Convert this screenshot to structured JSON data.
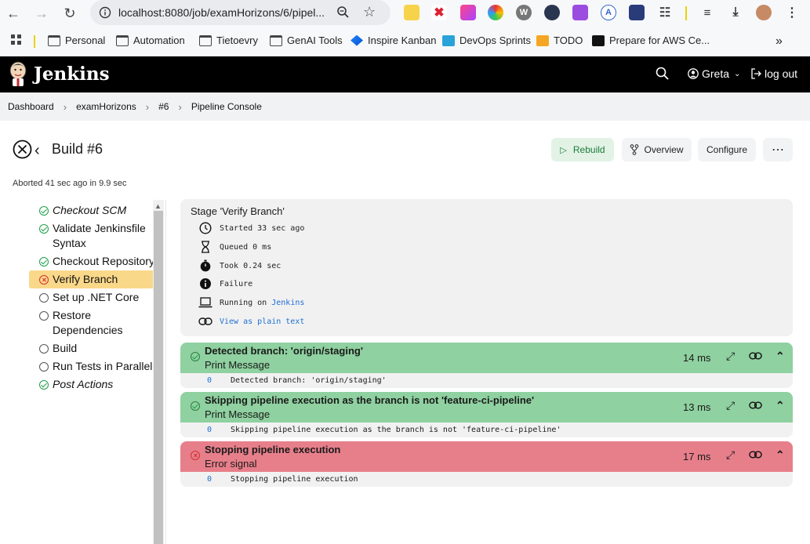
{
  "browser": {
    "url": "localhost:8080/job/examHorizons/6/pipel...",
    "bookmarks": [
      "Personal",
      "Automation",
      "Tietoevry",
      "GenAI Tools",
      "Inspire Kanban",
      "DevOps Sprints",
      "TODO",
      "Prepare for AWS Ce..."
    ]
  },
  "header": {
    "brand": "Jenkins",
    "user": "Greta",
    "logout": "log out"
  },
  "breadcrumb": [
    "Dashboard",
    "examHorizons",
    "#6",
    "Pipeline Console"
  ],
  "build": {
    "title": "Build #6",
    "status_line": "Aborted 41 sec ago in 9.9 sec",
    "buttons": {
      "rebuild": "Rebuild",
      "overview": "Overview",
      "configure": "Configure"
    }
  },
  "stages": [
    {
      "label": "Checkout SCM",
      "status": "success",
      "italic": true
    },
    {
      "label": "Validate Jenkinsfile Syntax",
      "status": "success",
      "italic": false
    },
    {
      "label": "Checkout Repository",
      "status": "success",
      "italic": false
    },
    {
      "label": "Verify Branch",
      "status": "failed",
      "italic": false,
      "active": true
    },
    {
      "label": "Set up .NET Core",
      "status": "pending",
      "italic": false
    },
    {
      "label": "Restore Dependencies",
      "status": "pending",
      "italic": false
    },
    {
      "label": "Build",
      "status": "pending",
      "italic": false
    },
    {
      "label": "Run Tests in Parallel",
      "status": "pending",
      "italic": false
    },
    {
      "label": "Post Actions",
      "status": "success",
      "italic": true
    }
  ],
  "stage_detail": {
    "title": "Stage 'Verify Branch'",
    "started": "Started 33 sec ago",
    "queued": "Queued 0 ms",
    "took": "Took 0.24 sec",
    "result": "Failure",
    "running_on_prefix": "Running on ",
    "running_on_node": "Jenkins",
    "plain_text": "View as plain text"
  },
  "steps": [
    {
      "title": "Detected branch: 'origin/staging'",
      "subtitle": "Print Message",
      "time": "14 ms",
      "status": "success",
      "log_line": "0",
      "log": "Detected branch: 'origin/staging'"
    },
    {
      "title": "Skipping pipeline execution as the branch is not 'feature-ci-pipeline'",
      "subtitle": "Print Message",
      "time": "13 ms",
      "status": "success",
      "log_line": "0",
      "log": "Skipping pipeline execution as the branch is not 'feature-ci-pipeline'"
    },
    {
      "title": "Stopping pipeline execution",
      "subtitle": "Error signal",
      "time": "17 ms",
      "status": "failed",
      "log_line": "0",
      "log": "Stopping pipeline execution"
    }
  ]
}
